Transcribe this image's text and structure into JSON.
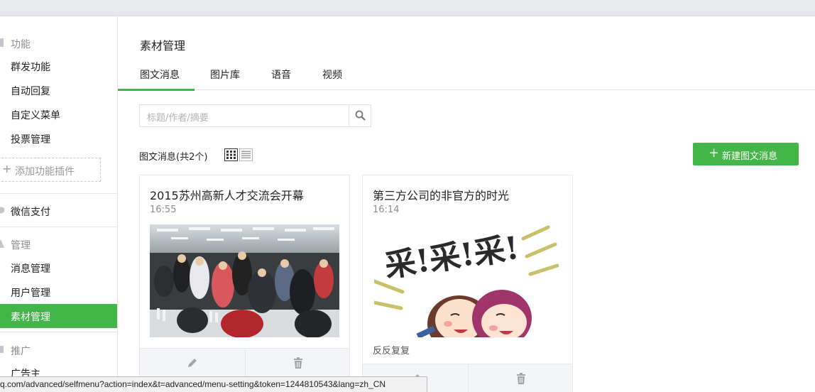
{
  "sidebar": {
    "sections": {
      "features": "功能",
      "payment": "微信支付",
      "manage": "管理",
      "promote": "推广"
    },
    "items": {
      "mass_send": "群发功能",
      "auto_reply": "自动回复",
      "custom_menu": "自定义菜单",
      "vote_manage": "投票管理",
      "add_plugin": "添加功能插件",
      "message_manage": "消息管理",
      "user_manage": "用户管理",
      "material_manage": "素材管理",
      "advertiser": "广告主"
    }
  },
  "main": {
    "page_title": "素材管理",
    "tabs": [
      "图文消息",
      "图片库",
      "语音",
      "视频"
    ],
    "active_tab": "图文消息",
    "search_placeholder": "标题/作者/摘要",
    "list_title": "图文消息(共2个)",
    "new_button": "新建图文消息"
  },
  "cards": [
    {
      "title": "2015苏州高新人才交流会开幕",
      "time": "16:55",
      "digest": ""
    },
    {
      "title": "第三方公司的非官方的时光",
      "time": "16:14",
      "digest": "反反复复"
    }
  ],
  "status_url": "q.com/advanced/selfmenu?action=index&t=advanced/menu-setting&token=1244810543&lang=zh_CN",
  "colors": {
    "accent": "#44b549",
    "border": "#e4e8eb",
    "topbar": "#e7e8eb"
  }
}
